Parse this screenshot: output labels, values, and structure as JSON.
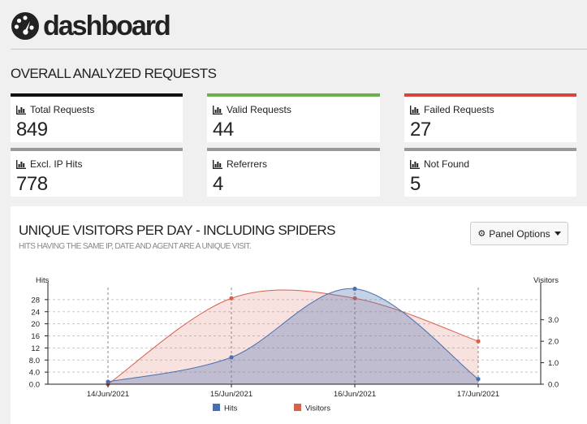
{
  "header": {
    "title": "dashboard",
    "icon": "dashboard-gauge-icon"
  },
  "overall": {
    "title": "OVERALL ANALYZED REQUESTS",
    "cards": [
      {
        "label": "Total Requests",
        "value": "849",
        "color": "#111111"
      },
      {
        "label": "Valid Requests",
        "value": "44",
        "color": "#6ab04c"
      },
      {
        "label": "Failed Requests",
        "value": "27",
        "color": "#d9443a"
      },
      {
        "label": "Excl. IP Hits",
        "value": "778",
        "color": "#999999"
      },
      {
        "label": "Referrers",
        "value": "4",
        "color": "#999999"
      },
      {
        "label": "Not Found",
        "value": "5",
        "color": "#999999"
      }
    ]
  },
  "visitors_panel": {
    "title": "UNIQUE VISITORS PER DAY - INCLUDING SPIDERS",
    "subtitle": "HITS HAVING THE SAME IP, DATE AND AGENT ARE A UNIQUE VISIT.",
    "options_button": "Panel Options"
  },
  "chart_data": {
    "type": "area",
    "categories": [
      "14/Jun/2021",
      "15/Jun/2021",
      "16/Jun/2021",
      "17/Jun/2021"
    ],
    "series": [
      {
        "name": "Hits",
        "axis": "left",
        "values": [
          0.8,
          8.9,
          31.6,
          1.7
        ],
        "color": "#4a6fb0"
      },
      {
        "name": "Visitors",
        "axis": "right",
        "values": [
          0.0,
          4.0,
          4.0,
          2.0
        ],
        "color": "#d9604c"
      }
    ],
    "left_axis": {
      "label": "Hits",
      "ticks": [
        "0.0",
        "4.0",
        "8.0",
        "12",
        "16",
        "20",
        "24",
        "28"
      ],
      "ylim": [
        0,
        32
      ]
    },
    "right_axis": {
      "label": "Visitors",
      "ticks": [
        "0.0",
        "1.0",
        "2.0",
        "3.0"
      ],
      "ylim": [
        0,
        4.5
      ]
    },
    "legend": [
      "Hits",
      "Visitors"
    ],
    "legend_position": "bottom",
    "grid": true
  }
}
